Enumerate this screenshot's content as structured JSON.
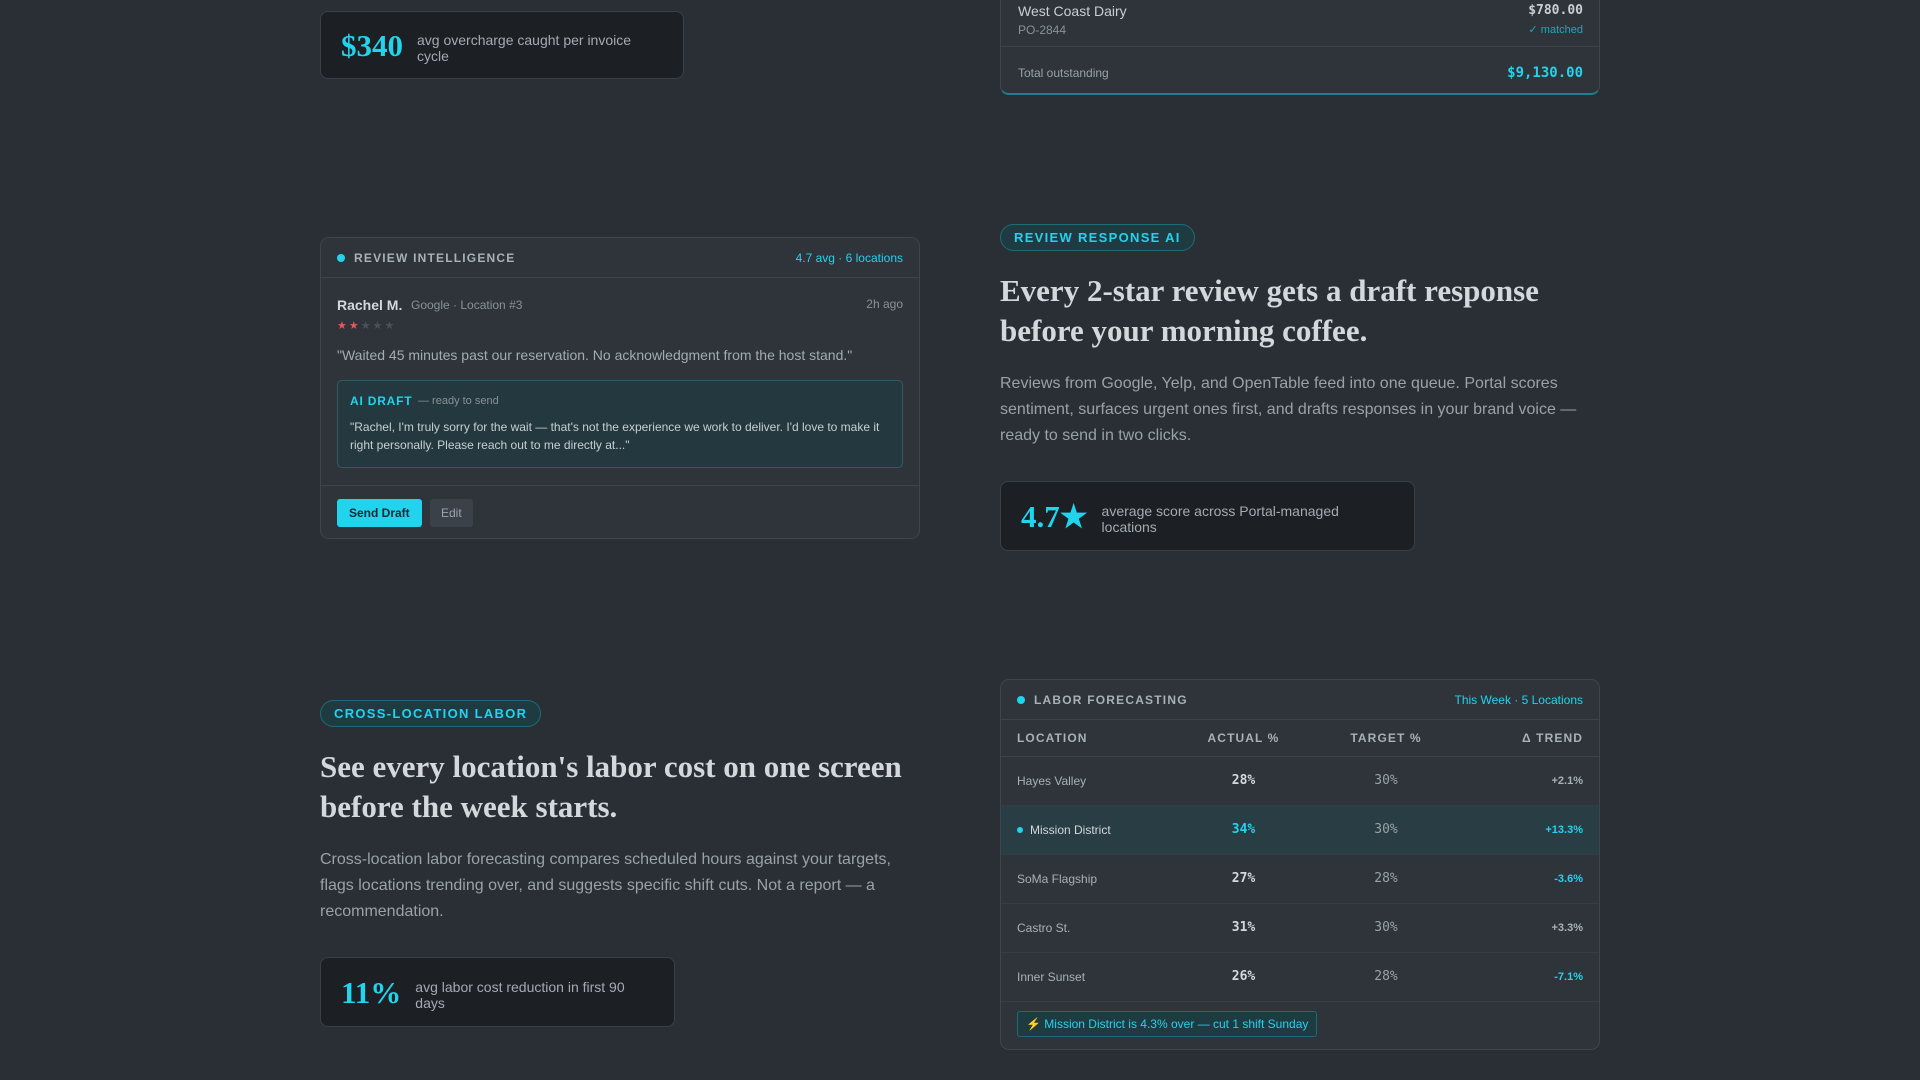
{
  "invoice_stat": {
    "value": "$340",
    "caption": "avg overcharge caught per invoice cycle"
  },
  "invoice_card": {
    "vendor": "West Coast Dairy",
    "po": "PO-2844",
    "amount": "$780.00",
    "status": "✓ matched",
    "total_label": "Total outstanding",
    "total_value": "$9,130.00"
  },
  "review_card": {
    "title": "REVIEW INTELLIGENCE",
    "meta": "4.7 avg · 6 locations",
    "reviewer": "Rachel M.",
    "source": "Google · Location #3",
    "time": "2h ago",
    "rating": 2,
    "rating_max": 5,
    "quote": "\"Waited 45 minutes past our reservation. No acknowledgment from the host stand.\"",
    "draft_label": "AI DRAFT",
    "draft_status": "— ready to send",
    "draft_text": "\"Rachel, I'm truly sorry for the wait — that's not the experience we work to deliver. I'd love to make it right personally. Please reach out to me directly at...\"",
    "send_label": "Send Draft",
    "edit_label": "Edit"
  },
  "review_section": {
    "badge": "REVIEW RESPONSE AI",
    "headline_line1": "Every 2-star review gets a draft response",
    "headline_line2": "before your morning coffee.",
    "body_line1": "Reviews from Google, Yelp, and OpenTable feed into one queue. Portal scores",
    "body_line2": "sentiment, surfaces urgent ones first, and drafts responses in your brand voice —",
    "body_line3": "ready to send in two clicks.",
    "stat_value": "4.7★",
    "stat_caption": "average score across Portal-managed locations"
  },
  "labor_section": {
    "badge": "CROSS-LOCATION LABOR",
    "headline_line1": "See every location's labor cost on one screen",
    "headline_line2": "before the week starts.",
    "body_line1": "Cross-location labor forecasting compares scheduled hours against your targets,",
    "body_line2": "flags locations trending over, and suggests specific shift cuts. Not a report — a",
    "body_line3": "recommendation.",
    "stat_value": "11%",
    "stat_caption": "avg labor cost reduction in first 90 days"
  },
  "labor_card": {
    "title": "LABOR FORECASTING",
    "meta": "This Week · 5 Locations",
    "columns": [
      "LOCATION",
      "ACTUAL %",
      "TARGET %",
      "Δ TREND"
    ],
    "rows": [
      {
        "location": "Hayes Valley",
        "actual": "28%",
        "target": "30%",
        "trend": "+2.1%"
      },
      {
        "location": "Mission District",
        "actual": "34%",
        "target": "30%",
        "trend": "+13.3%"
      },
      {
        "location": "SoMa Flagship",
        "actual": "27%",
        "target": "28%",
        "trend": "-3.6%"
      },
      {
        "location": "Castro St.",
        "actual": "31%",
        "target": "30%",
        "trend": "+3.3%"
      },
      {
        "location": "Inner Sunset",
        "actual": "26%",
        "target": "28%",
        "trend": "-7.1%"
      }
    ],
    "alert": "⚡ Mission District is 4.3% over — cut 1 shift Sunday"
  },
  "colors": {
    "accent": "#22d3ee",
    "background": "#2a2f35",
    "star_on": "#e05a5a",
    "star_off": "#4a5158"
  }
}
